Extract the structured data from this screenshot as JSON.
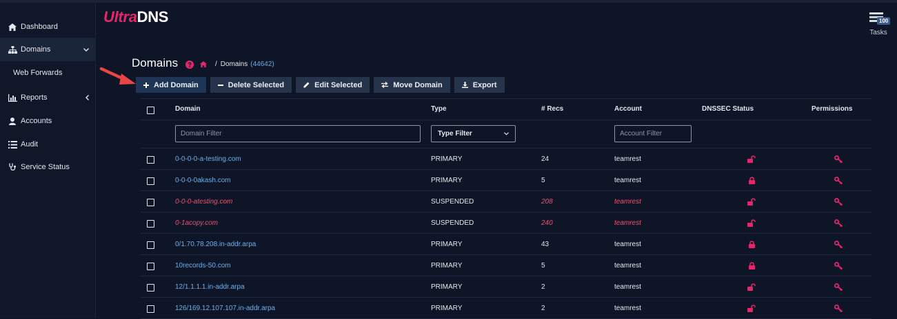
{
  "app": {
    "logo_part1": "Ultra",
    "logo_part2": "DNS"
  },
  "sidebar": {
    "items": [
      {
        "label": "Dashboard",
        "icon": "home-icon"
      },
      {
        "label": "Domains",
        "icon": "sitemap-icon",
        "active": true
      },
      {
        "label": "Web Forwards",
        "sub": true
      },
      {
        "label": "Reports",
        "icon": "bar-chart-icon"
      },
      {
        "label": "Accounts",
        "icon": "user-icon"
      },
      {
        "label": "Audit",
        "icon": "list-icon"
      },
      {
        "label": "Service Status",
        "icon": "stethoscope-icon"
      }
    ]
  },
  "tasks": {
    "label": "Tasks",
    "badge": "100"
  },
  "page": {
    "title": "Domains",
    "breadcrumb_current": "Domains",
    "breadcrumb_count": "(44642)"
  },
  "toolbar": {
    "add_label": "Add Domain",
    "delete_label": "Delete Selected",
    "edit_label": "Edit Selected",
    "move_label": "Move Domain",
    "export_label": "Export"
  },
  "table": {
    "headers": {
      "domain": "Domain",
      "type": "Type",
      "recs": "# Recs",
      "account": "Account",
      "dnssec": "DNSSEC Status",
      "permissions": "Permissions"
    },
    "filters": {
      "domain_placeholder": "Domain Filter",
      "type_label": "Type Filter",
      "account_placeholder": "Account Filter"
    },
    "rows": [
      {
        "domain": "0-0-0-0-a-testing.com",
        "type": "PRIMARY",
        "recs": "24",
        "account": "teamrest",
        "locked": false,
        "suspended": false
      },
      {
        "domain": "0-0-0-0akash.com",
        "type": "PRIMARY",
        "recs": "5",
        "account": "teamrest",
        "locked": true,
        "suspended": false
      },
      {
        "domain": "0-0-0-atesting.com",
        "type": "SUSPENDED",
        "recs": "208",
        "account": "teamrest",
        "locked": false,
        "suspended": true
      },
      {
        "domain": "0-1acopy.com",
        "type": "SUSPENDED",
        "recs": "240",
        "account": "teamrest",
        "locked": false,
        "suspended": true
      },
      {
        "domain": "0/1.70.78.208.in-addr.arpa",
        "type": "PRIMARY",
        "recs": "43",
        "account": "teamrest",
        "locked": true,
        "suspended": false
      },
      {
        "domain": "10records-50.com",
        "type": "PRIMARY",
        "recs": "5",
        "account": "teamrest",
        "locked": true,
        "suspended": false
      },
      {
        "domain": "12/1.1.1.1.in-addr.arpa",
        "type": "PRIMARY",
        "recs": "2",
        "account": "teamrest",
        "locked": false,
        "suspended": false
      },
      {
        "domain": "126/169.12.107.107.in-addr.arpa",
        "type": "PRIMARY",
        "recs": "2",
        "account": "teamrest",
        "locked": false,
        "suspended": false
      }
    ]
  },
  "colors": {
    "accent": "#e5266b",
    "link": "#6fb0ec",
    "suspended": "#ef4f6c",
    "background": "#0d1526"
  }
}
